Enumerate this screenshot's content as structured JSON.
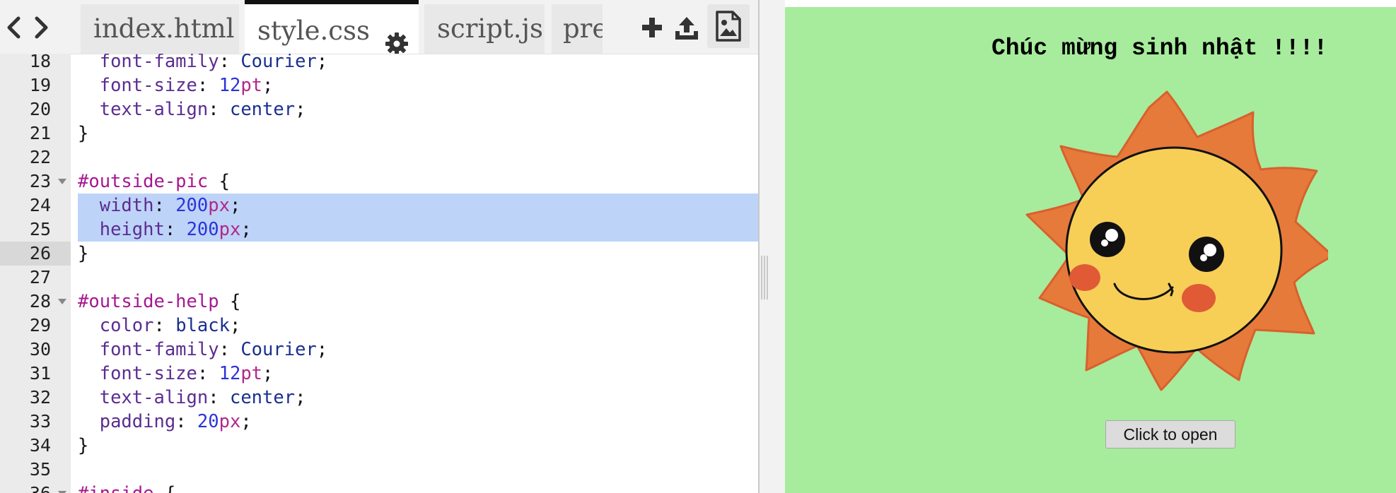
{
  "tabs": [
    {
      "label": "index.html",
      "active": false
    },
    {
      "label": "style.css",
      "active": true
    },
    {
      "label": "script.js",
      "active": false
    },
    {
      "label": "pre",
      "active": false
    }
  ],
  "toolbar": {
    "back_icon": "chevron-left-icon",
    "forward_icon": "chevron-right-icon",
    "add_icon": "plus-icon",
    "upload_icon": "upload-icon",
    "image_icon": "image-file-icon",
    "settings_icon": "gear-icon"
  },
  "editor": {
    "active_line": "26",
    "selected_lines": [
      "24",
      "25"
    ],
    "lines": [
      {
        "num": "18",
        "tokens": [
          {
            "t": "  "
          },
          {
            "t": "font-family",
            "c": "prop"
          },
          {
            "t": ": ",
            "c": "punc"
          },
          {
            "t": "Courier",
            "c": "str"
          },
          {
            "t": ";",
            "c": "punc"
          }
        ]
      },
      {
        "num": "19",
        "tokens": [
          {
            "t": "  "
          },
          {
            "t": "font-size",
            "c": "prop"
          },
          {
            "t": ": ",
            "c": "punc"
          },
          {
            "t": "12",
            "c": "num"
          },
          {
            "t": "pt",
            "c": "unit"
          },
          {
            "t": ";",
            "c": "punc"
          }
        ]
      },
      {
        "num": "20",
        "tokens": [
          {
            "t": "  "
          },
          {
            "t": "text-align",
            "c": "prop"
          },
          {
            "t": ": ",
            "c": "punc"
          },
          {
            "t": "center",
            "c": "str"
          },
          {
            "t": ";",
            "c": "punc"
          }
        ]
      },
      {
        "num": "21",
        "tokens": [
          {
            "t": "}",
            "c": "punc"
          }
        ]
      },
      {
        "num": "22",
        "tokens": []
      },
      {
        "num": "23",
        "fold": true,
        "tokens": [
          {
            "t": "#outside-pic",
            "c": "sel"
          },
          {
            "t": " {",
            "c": "punc"
          }
        ]
      },
      {
        "num": "24",
        "tokens": [
          {
            "t": "  "
          },
          {
            "t": "width",
            "c": "prop"
          },
          {
            "t": ": ",
            "c": "punc"
          },
          {
            "t": "200",
            "c": "num"
          },
          {
            "t": "px",
            "c": "unit"
          },
          {
            "t": ";",
            "c": "punc"
          }
        ]
      },
      {
        "num": "25",
        "tokens": [
          {
            "t": "  "
          },
          {
            "t": "height",
            "c": "prop"
          },
          {
            "t": ": ",
            "c": "punc"
          },
          {
            "t": "200",
            "c": "num"
          },
          {
            "t": "px",
            "c": "unit"
          },
          {
            "t": ";",
            "c": "punc"
          }
        ]
      },
      {
        "num": "26",
        "tokens": [
          {
            "t": "}",
            "c": "punc"
          }
        ]
      },
      {
        "num": "27",
        "tokens": []
      },
      {
        "num": "28",
        "fold": true,
        "tokens": [
          {
            "t": "#outside-help",
            "c": "sel"
          },
          {
            "t": " {",
            "c": "punc"
          }
        ]
      },
      {
        "num": "29",
        "tokens": [
          {
            "t": "  "
          },
          {
            "t": "color",
            "c": "prop"
          },
          {
            "t": ": ",
            "c": "punc"
          },
          {
            "t": "black",
            "c": "str"
          },
          {
            "t": ";",
            "c": "punc"
          }
        ]
      },
      {
        "num": "30",
        "tokens": [
          {
            "t": "  "
          },
          {
            "t": "font-family",
            "c": "prop"
          },
          {
            "t": ": ",
            "c": "punc"
          },
          {
            "t": "Courier",
            "c": "str"
          },
          {
            "t": ";",
            "c": "punc"
          }
        ]
      },
      {
        "num": "31",
        "tokens": [
          {
            "t": "  "
          },
          {
            "t": "font-size",
            "c": "prop"
          },
          {
            "t": ": ",
            "c": "punc"
          },
          {
            "t": "12",
            "c": "num"
          },
          {
            "t": "pt",
            "c": "unit"
          },
          {
            "t": ";",
            "c": "punc"
          }
        ]
      },
      {
        "num": "32",
        "tokens": [
          {
            "t": "  "
          },
          {
            "t": "text-align",
            "c": "prop"
          },
          {
            "t": ": ",
            "c": "punc"
          },
          {
            "t": "center",
            "c": "str"
          },
          {
            "t": ";",
            "c": "punc"
          }
        ]
      },
      {
        "num": "33",
        "tokens": [
          {
            "t": "  "
          },
          {
            "t": "padding",
            "c": "prop"
          },
          {
            "t": ": ",
            "c": "punc"
          },
          {
            "t": "20",
            "c": "num"
          },
          {
            "t": "px",
            "c": "unit"
          },
          {
            "t": ";",
            "c": "punc"
          }
        ]
      },
      {
        "num": "34",
        "tokens": [
          {
            "t": "}",
            "c": "punc"
          }
        ]
      },
      {
        "num": "35",
        "tokens": []
      },
      {
        "num": "36",
        "fold": true,
        "tokens": [
          {
            "t": "#inside",
            "c": "sel"
          },
          {
            "t": " {",
            "c": "punc"
          }
        ]
      }
    ]
  },
  "preview": {
    "background": "#a6ec9c",
    "title": "Chúc mừng sinh nhật !!!!",
    "image_name": "smiling-sun",
    "button_label": "Click to open"
  }
}
